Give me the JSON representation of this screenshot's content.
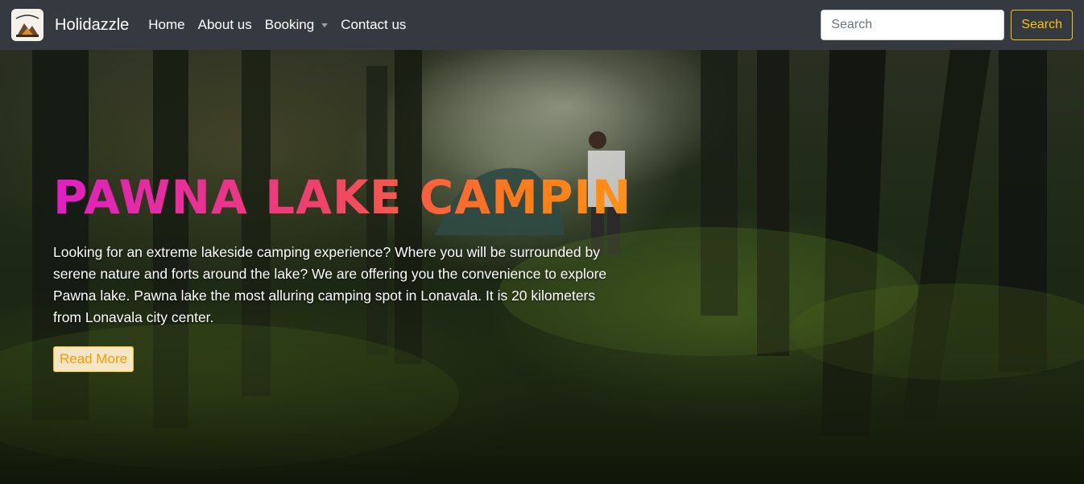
{
  "navbar": {
    "brand": "Holidazzle",
    "links": [
      {
        "label": "Home"
      },
      {
        "label": "About us"
      },
      {
        "label": "Booking"
      },
      {
        "label": "Contact us"
      }
    ],
    "search": {
      "placeholder": "Search",
      "button_label": "Search"
    }
  },
  "hero": {
    "title": "PAWNA LAKE CAMPING",
    "description": "Looking for an extreme lakeside camping experience? Where you will be surrounded by serene nature and forts around the lake? We are offering you the convenience to explore Pawna lake. Pawna lake the most alluring camping spot in Lonavala. It is 20 kilometers from Lonavala city center.",
    "cta_label": "Read More"
  },
  "colors": {
    "navbar_bg": "#343a40",
    "accent": "#ffc107",
    "title_gradient": [
      "#e01fc4",
      "#f0406e",
      "#ff7a1a"
    ]
  },
  "icons": {
    "brand_logo": "adventure-logo-icon",
    "booking_dropdown": "caret-down-icon"
  }
}
